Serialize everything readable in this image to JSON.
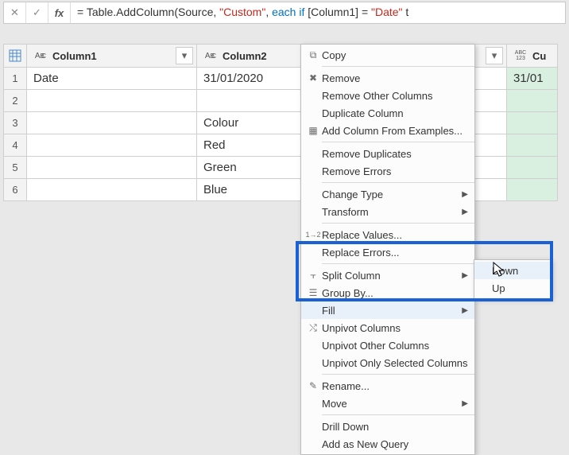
{
  "formula": {
    "prefix": "= ",
    "fn": "Table.AddColumn",
    "open": "(Source, ",
    "str1": "\"Custom\"",
    "mid": ", ",
    "kw_each": "each",
    "sp1": " ",
    "kw_if": "if",
    "sp2": " [Column1] = ",
    "str2": "\"Date\"",
    "tail": " t"
  },
  "columns": {
    "col1": {
      "type": "AᴮC",
      "name": "Column1"
    },
    "col2": {
      "type": "AᴮC",
      "name": "Column2"
    },
    "col3": {
      "type": "ABC\n123",
      "name": "Cu"
    }
  },
  "rows": [
    {
      "n": "1",
      "c1": "Date",
      "c2": "31/01/2020",
      "c3": "31/01"
    },
    {
      "n": "2",
      "c1": "",
      "c2": "",
      "c3": ""
    },
    {
      "n": "3",
      "c1": "",
      "c2": "Colour",
      "c3": ""
    },
    {
      "n": "4",
      "c1": "",
      "c2": "Red",
      "c3": ""
    },
    {
      "n": "5",
      "c1": "",
      "c2": "Green",
      "c3": ""
    },
    {
      "n": "6",
      "c1": "",
      "c2": "Blue",
      "c3": ""
    }
  ],
  "menu": {
    "copy": "Copy",
    "remove": "Remove",
    "remove_other": "Remove Other Columns",
    "duplicate": "Duplicate Column",
    "add_from_examples": "Add Column From Examples...",
    "remove_dupes": "Remove Duplicates",
    "remove_errors": "Remove Errors",
    "change_type": "Change Type",
    "transform": "Transform",
    "replace_values": "Replace Values...",
    "replace_errors": "Replace Errors...",
    "split_column": "Split Column",
    "group_by": "Group By...",
    "fill": "Fill",
    "unpivot": "Unpivot Columns",
    "unpivot_other": "Unpivot Other Columns",
    "unpivot_sel": "Unpivot Only Selected Columns",
    "rename": "Rename...",
    "move": "Move",
    "drill_down": "Drill Down",
    "add_query": "Add as New Query"
  },
  "submenu": {
    "down": "Down",
    "up": "Up"
  }
}
